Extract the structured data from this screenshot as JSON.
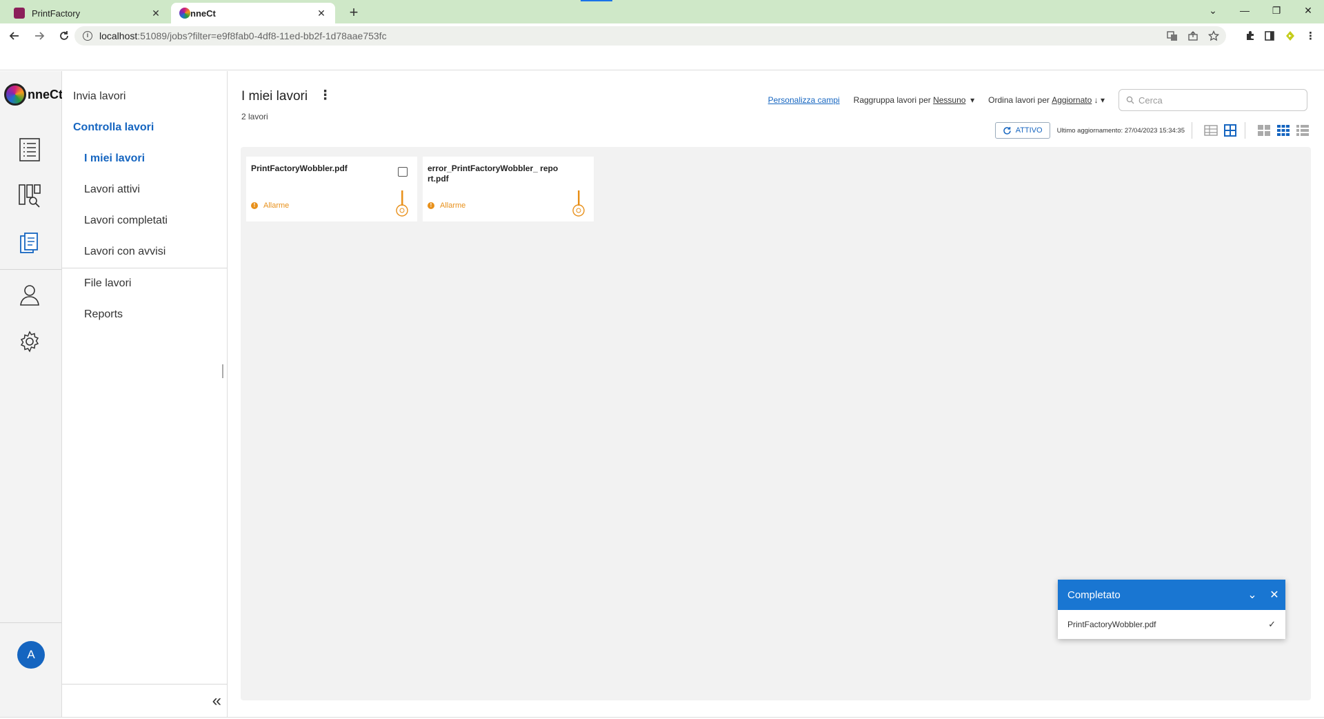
{
  "browser": {
    "tabs": [
      {
        "title": "PrintFactory",
        "close": "✕"
      },
      {
        "title": "nneCt",
        "close": "✕"
      }
    ],
    "new_tab": "+",
    "window_controls": {
      "tab_search": "⌄",
      "minimize": "—",
      "restore": "❐",
      "close": "✕"
    },
    "url_host": "localhost",
    "url_rest": ":51089/jobs?filter=e9f8fab0-4df8-11ed-bb2f-1d78aae753fc"
  },
  "app": {
    "brand_text": "nneCt",
    "avatar_initial": "A"
  },
  "subnav": {
    "send_jobs": "Invia lavori",
    "control_jobs": "Controlla lavori",
    "my_jobs": "I miei lavori",
    "active_jobs": "Lavori attivi",
    "completed_jobs": "Lavori completati",
    "jobs_with_warnings": "Lavori con avvisi",
    "job_queues": "File lavori",
    "reports": "Reports",
    "collapse": "«"
  },
  "main": {
    "title": "I miei lavori",
    "kebab": "⋮",
    "count": "2 lavori",
    "customize_fields": "Personalizza campi",
    "group_by_label": "Raggruppa lavori per",
    "group_by_value": "Nessuno",
    "sort_by_label": "Ordina lavori per",
    "sort_by_value": "Aggiornato",
    "sort_icon": "↓",
    "dropdown_caret": "▾",
    "search_placeholder": "Cerca",
    "active_button": "ATTIVO",
    "last_update": "Ultimo aggiornamento: 27/04/2023 15:34:35"
  },
  "jobs": [
    {
      "name": "PrintFactoryWobbler.pdf",
      "status": "Allarme"
    },
    {
      "name": "error_PrintFactoryWobbler_ report.pdf",
      "status": "Allarme"
    }
  ],
  "toast": {
    "title": "Completato",
    "chevron": "⌄",
    "close": "✕",
    "file": "PrintFactoryWobbler.pdf",
    "check": "✓"
  },
  "colors": {
    "accent": "#1565c0",
    "alarm": "#e8901a",
    "toast_header": "#1976d2",
    "tabstrip": "#cfe8c8"
  }
}
